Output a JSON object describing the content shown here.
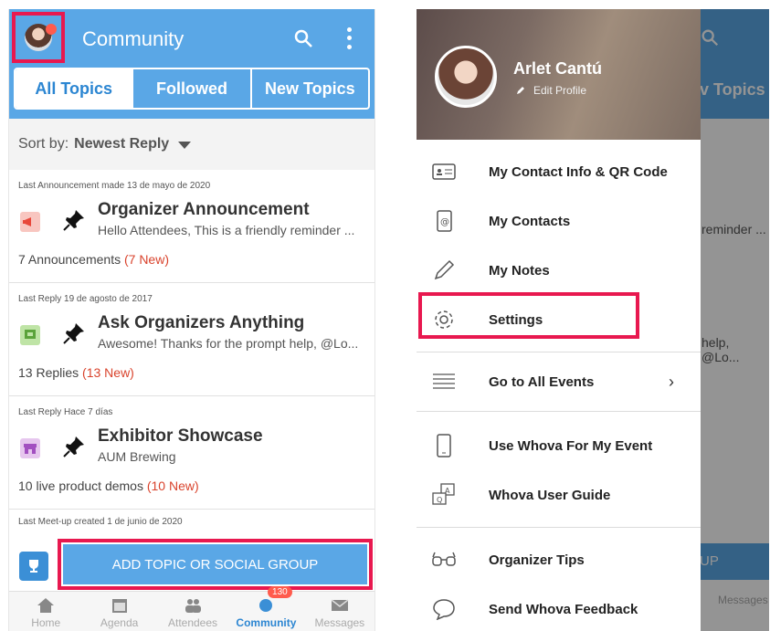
{
  "left": {
    "title": "Community",
    "tabs": [
      "All Topics",
      "Followed",
      "New Topics"
    ],
    "sort": {
      "label": "Sort by:",
      "value": "Newest Reply"
    },
    "topics": [
      {
        "meta": "Last Announcement made 13 de mayo de 2020",
        "title": "Organizer Announcement",
        "subtitle": "Hello Attendees, This is a friendly reminder ...",
        "count": "7 Announcements",
        "new": "(7 New)"
      },
      {
        "meta": "Last Reply 19 de agosto de 2017",
        "title": "Ask Organizers Anything",
        "subtitle": "Awesome! Thanks for the prompt help, @Lo...",
        "count": "13 Replies",
        "new": "(13 New)"
      },
      {
        "meta": "Last Reply Hace 7 días",
        "title": "Exhibitor Showcase",
        "subtitle": "AUM Brewing",
        "count": "10 live product demos",
        "new": "(10 New)"
      }
    ],
    "meetup_meta": "Last Meet-up created 1 de junio de 2020",
    "add_button": "ADD TOPIC OR SOCIAL GROUP",
    "nav": [
      {
        "label": "Home",
        "icon": "home-icon"
      },
      {
        "label": "Agenda",
        "icon": "calendar-icon"
      },
      {
        "label": "Attendees",
        "icon": "people-icon"
      },
      {
        "label": "Community",
        "icon": "chat-icon",
        "badge": "130"
      },
      {
        "label": "Messages",
        "icon": "mail-icon"
      }
    ]
  },
  "right": {
    "behind": {
      "tab": "v Topics",
      "reminder": "reminder ...",
      "help": "help, @Lo...",
      "up": "UP",
      "messages": "Messages"
    },
    "profile": {
      "name": "Arlet Cantú",
      "edit": "Edit Profile"
    },
    "menu": [
      {
        "label": "My Contact Info & QR Code",
        "icon": "contact-card-icon"
      },
      {
        "label": "My Contacts",
        "icon": "address-book-icon"
      },
      {
        "label": "My Notes",
        "icon": "pencil-icon"
      },
      {
        "label": "Settings",
        "icon": "gear-icon"
      },
      {
        "label": "Go to All Events",
        "icon": "list-icon"
      },
      {
        "label": "Use Whova For My Event",
        "icon": "phone-icon"
      },
      {
        "label": "Whova User Guide",
        "icon": "qa-icon"
      },
      {
        "label": "Organizer Tips",
        "icon": "glasses-icon"
      },
      {
        "label": "Send Whova Feedback",
        "icon": "speech-bubble-icon"
      }
    ]
  },
  "colors": {
    "primary": "#5aa7e6",
    "highlight": "#e8184f",
    "new": "#d9432c"
  }
}
